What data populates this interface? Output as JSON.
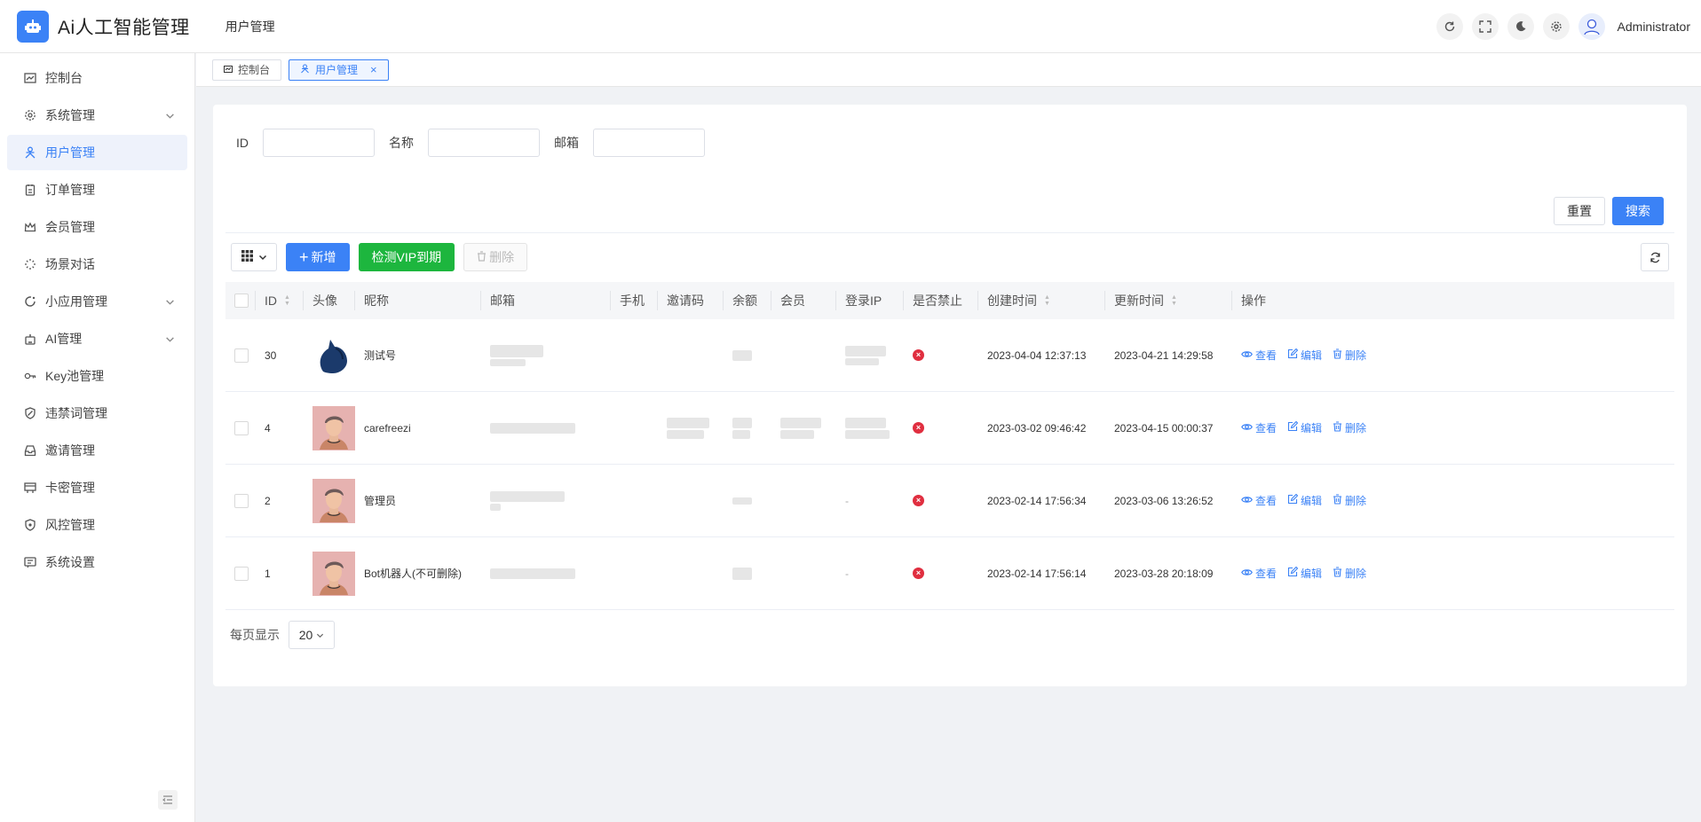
{
  "header": {
    "app_title": "Ai人工智能管理",
    "crumb": "用户管理",
    "user_name": "Administrator",
    "icons": [
      "refresh-icon",
      "fullscreen-icon",
      "dark-mode-icon",
      "settings-icon"
    ]
  },
  "sidebar": {
    "items": [
      {
        "label": "控制台",
        "icon": "dashboard-icon",
        "expandable": false,
        "active": false
      },
      {
        "label": "系统管理",
        "icon": "gear-icon",
        "expandable": true,
        "active": false
      },
      {
        "label": "用户管理",
        "icon": "user-icon",
        "expandable": false,
        "active": true
      },
      {
        "label": "订单管理",
        "icon": "order-icon",
        "expandable": false,
        "active": false
      },
      {
        "label": "会员管理",
        "icon": "crown-icon",
        "expandable": false,
        "active": false
      },
      {
        "label": "场景对话",
        "icon": "scene-icon",
        "expandable": false,
        "active": false
      },
      {
        "label": "小应用管理",
        "icon": "app-icon",
        "expandable": true,
        "active": false
      },
      {
        "label": "AI管理",
        "icon": "robot-icon",
        "expandable": true,
        "active": false
      },
      {
        "label": "Key池管理",
        "icon": "key-icon",
        "expandable": false,
        "active": false
      },
      {
        "label": "违禁词管理",
        "icon": "shield-icon",
        "expandable": false,
        "active": false
      },
      {
        "label": "邀请管理",
        "icon": "inbox-icon",
        "expandable": false,
        "active": false
      },
      {
        "label": "卡密管理",
        "icon": "card-icon",
        "expandable": false,
        "active": false
      },
      {
        "label": "风控管理",
        "icon": "risk-icon",
        "expandable": false,
        "active": false
      },
      {
        "label": "系统设置",
        "icon": "settings-list-icon",
        "expandable": false,
        "active": false
      }
    ]
  },
  "tabs": [
    {
      "label": "控制台",
      "active": false
    },
    {
      "label": "用户管理",
      "active": true
    }
  ],
  "filters": {
    "id_label": "ID",
    "id_value": "",
    "name_label": "名称",
    "name_value": "",
    "email_label": "邮箱",
    "email_value": ""
  },
  "actions": {
    "reset": "重置",
    "search": "搜索",
    "add": "新增",
    "check_vip": "检测VIP到期",
    "delete": "删除"
  },
  "table": {
    "columns": [
      "ID",
      "头像",
      "昵称",
      "邮箱",
      "手机",
      "邀请码",
      "余额",
      "会员",
      "登录IP",
      "是否禁止",
      "创建时间",
      "更新时间",
      "操作"
    ],
    "rows": [
      {
        "id": "30",
        "avatar": "cat-avatar",
        "nickname": "测试号",
        "login_ip_dash": "",
        "created": "2023-04-04 12:37:13",
        "updated": "2023-04-21 14:29:58"
      },
      {
        "id": "4",
        "avatar": "person-avatar",
        "nickname": "carefreezi",
        "login_ip_dash": "",
        "created": "2023-03-02 09:46:42",
        "updated": "2023-04-15 00:00:37"
      },
      {
        "id": "2",
        "avatar": "person-avatar",
        "nickname": "管理员",
        "login_ip_dash": "-",
        "created": "2023-02-14 17:56:34",
        "updated": "2023-03-06 13:26:52"
      },
      {
        "id": "1",
        "avatar": "person-avatar",
        "nickname": "Bot机器人(不可删除)",
        "login_ip_dash": "-",
        "created": "2023-02-14 17:56:14",
        "updated": "2023-03-28 20:18:09"
      }
    ],
    "row_actions": {
      "view": "查看",
      "edit": "编辑",
      "delete": "删除"
    }
  },
  "pagination": {
    "label": "每页显示",
    "page_size": "20"
  },
  "colors": {
    "primary": "#3b82f6",
    "success": "#1db63e",
    "danger": "#e02e3f"
  }
}
